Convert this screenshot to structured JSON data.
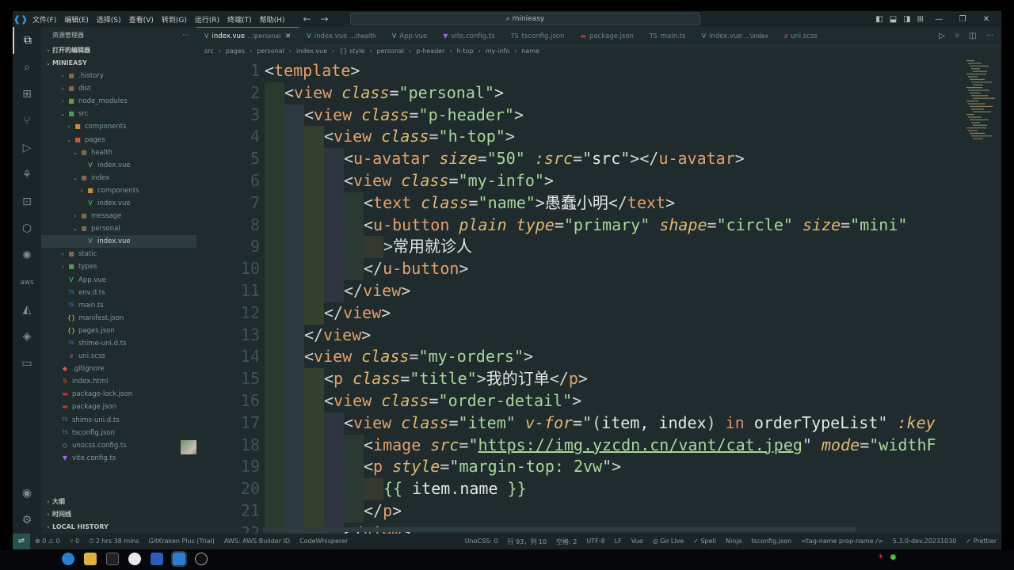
{
  "title_bar": {
    "menu": [
      "文件(F)",
      "编辑(E)",
      "选择(S)",
      "查看(V)",
      "转到(G)",
      "运行(R)",
      "终端(T)",
      "帮助(H)"
    ],
    "search": "minieasy"
  },
  "sidebar": {
    "title": "资源管理器",
    "open_editors": "打开的编辑器",
    "project": "MINIEASY",
    "tree": [
      {
        "name": ".history",
        "depth": 1,
        "kind": "folder",
        "icon_color": "#7a6a55"
      },
      {
        "name": "dist",
        "depth": 1,
        "kind": "folder",
        "icon_color": "#7a6a55"
      },
      {
        "name": "node_modules",
        "depth": 1,
        "kind": "folder",
        "icon_color": "#6e9a4e"
      },
      {
        "name": "src",
        "depth": 1,
        "kind": "folder-open",
        "icon_color": "#4d9d5f"
      },
      {
        "name": "components",
        "depth": 2,
        "kind": "folder",
        "icon_color": "#c9883a"
      },
      {
        "name": "pages",
        "depth": 2,
        "kind": "folder-open",
        "icon_color": "#c95a3a"
      },
      {
        "name": "health",
        "depth": 3,
        "kind": "folder-open",
        "icon_color": "#7a6a55"
      },
      {
        "name": "index.vue",
        "depth": 4,
        "kind": "vue",
        "icon_color": "#4fc08d"
      },
      {
        "name": "index",
        "depth": 3,
        "kind": "folder-open",
        "icon_color": "#7a6a55"
      },
      {
        "name": "components",
        "depth": 4,
        "kind": "folder",
        "icon_color": "#c9883a"
      },
      {
        "name": "index.vue",
        "depth": 4,
        "kind": "vue",
        "icon_color": "#4fc08d"
      },
      {
        "name": "message",
        "depth": 3,
        "kind": "folder",
        "icon_color": "#7a6a55"
      },
      {
        "name": "personal",
        "depth": 3,
        "kind": "folder-open",
        "icon_color": "#7a6a55"
      },
      {
        "name": "index.vue",
        "depth": 4,
        "kind": "vue",
        "icon_color": "#4fc08d",
        "selected": true
      },
      {
        "name": "static",
        "depth": 1,
        "kind": "folder",
        "icon_color": "#7a6a55"
      },
      {
        "name": "types",
        "depth": 1,
        "kind": "folder",
        "icon_color": "#4d9d5f"
      },
      {
        "name": "App.vue",
        "depth": 1,
        "kind": "vue",
        "icon_color": "#4fc08d"
      },
      {
        "name": "env.d.ts",
        "depth": 1,
        "kind": "ts",
        "icon_color": "#3a8fd8"
      },
      {
        "name": "main.ts",
        "depth": 1,
        "kind": "ts",
        "icon_color": "#3a8fd8"
      },
      {
        "name": "manifest.json",
        "depth": 1,
        "kind": "json",
        "icon_color": "#d8c050"
      },
      {
        "name": "pages.json",
        "depth": 1,
        "kind": "json",
        "icon_color": "#d8c050"
      },
      {
        "name": "shime-uni.d.ts",
        "depth": 1,
        "kind": "ts",
        "icon_color": "#3a8fd8"
      },
      {
        "name": "uni.scss",
        "depth": 1,
        "kind": "scss",
        "icon_color": "#c76494"
      },
      {
        "name": ".gitignore",
        "depth": 0,
        "kind": "git",
        "icon_color": "#e05a3a"
      },
      {
        "name": "index.html",
        "depth": 0,
        "kind": "html",
        "icon_color": "#e06a3a"
      },
      {
        "name": "package-lock.json",
        "depth": 0,
        "kind": "npm",
        "icon_color": "#c03a3a"
      },
      {
        "name": "package.json",
        "depth": 0,
        "kind": "npm",
        "icon_color": "#c03a3a"
      },
      {
        "name": "shims-uni.d.ts",
        "depth": 0,
        "kind": "ts",
        "icon_color": "#3a8fd8"
      },
      {
        "name": "tsconfig.json",
        "depth": 0,
        "kind": "ts",
        "icon_color": "#3a8fd8"
      },
      {
        "name": "unocss.config.ts",
        "depth": 0,
        "kind": "uno",
        "icon_color": "#aaaaaa"
      },
      {
        "name": "vite.config.ts",
        "depth": 0,
        "kind": "vite",
        "icon_color": "#9a6af0"
      }
    ],
    "bottom_sections": [
      "大纲",
      "时间线",
      "LOCAL HISTORY"
    ]
  },
  "editor": {
    "tabs": [
      {
        "name": "index.vue",
        "desc": "...\\personal",
        "icon": "V",
        "icon_color": "#4fc08d",
        "active": true
      },
      {
        "name": "index.vue",
        "desc": "...\\health",
        "icon": "V",
        "icon_color": "#4fc08d"
      },
      {
        "name": "App.vue",
        "desc": "",
        "icon": "V",
        "icon_color": "#4fc08d"
      },
      {
        "name": "vite.config.ts",
        "desc": "",
        "icon": "▼",
        "icon_color": "#9a6af0"
      },
      {
        "name": "tsconfig.json",
        "desc": "",
        "icon": "TS",
        "icon_color": "#3a8fd8"
      },
      {
        "name": "package.json",
        "desc": "",
        "icon": "▬",
        "icon_color": "#c03a3a"
      },
      {
        "name": "main.ts",
        "desc": "",
        "icon": "TS",
        "icon_color": "#3a8fd8"
      },
      {
        "name": "index.vue",
        "desc": "...\\index",
        "icon": "V",
        "icon_color": "#4fc08d"
      },
      {
        "name": "uni.scss",
        "desc": "",
        "icon": "∂",
        "icon_color": "#c76494"
      }
    ],
    "breadcrumb": [
      "src",
      "pages",
      "personal",
      "index.vue",
      "{} style",
      "personal",
      "p-header",
      "h-top",
      "my-info",
      "name"
    ],
    "lines": [
      {
        "n": 1,
        "i": 0,
        "tokens": [
          [
            "punc",
            "<"
          ],
          [
            "tag",
            "template"
          ],
          [
            "punc",
            ">"
          ]
        ]
      },
      {
        "n": 2,
        "i": 1,
        "tokens": [
          [
            "punc",
            "<"
          ],
          [
            "tag",
            "view "
          ],
          [
            "attr",
            "class"
          ],
          [
            "punc",
            "="
          ],
          [
            "str",
            "\"personal\""
          ],
          [
            "punc",
            ">"
          ]
        ]
      },
      {
        "n": 3,
        "i": 2,
        "tokens": [
          [
            "punc",
            "<"
          ],
          [
            "tag",
            "view "
          ],
          [
            "attr",
            "class"
          ],
          [
            "punc",
            "="
          ],
          [
            "str",
            "\"p-header\""
          ],
          [
            "punc",
            ">"
          ]
        ]
      },
      {
        "n": 4,
        "i": 3,
        "tokens": [
          [
            "punc",
            "<"
          ],
          [
            "tag",
            "view "
          ],
          [
            "attr",
            "class"
          ],
          [
            "punc",
            "="
          ],
          [
            "str",
            "\"h-top\""
          ],
          [
            "punc",
            ">"
          ]
        ]
      },
      {
        "n": 5,
        "i": 4,
        "tokens": [
          [
            "punc",
            "<"
          ],
          [
            "tag",
            "u-avatar "
          ],
          [
            "attr",
            "size"
          ],
          [
            "punc",
            "="
          ],
          [
            "str",
            "\"50\""
          ],
          [
            "plain",
            " "
          ],
          [
            "attr",
            ":src"
          ],
          [
            "punc",
            "="
          ],
          [
            "punc",
            "\""
          ],
          [
            "plain",
            "src"
          ],
          [
            "punc",
            "\">"
          ],
          [
            "punc",
            "</"
          ],
          [
            "tag",
            "u-avatar"
          ],
          [
            "punc",
            ">"
          ]
        ]
      },
      {
        "n": 6,
        "i": 4,
        "tokens": [
          [
            "punc",
            "<"
          ],
          [
            "tag",
            "view "
          ],
          [
            "attr",
            "class"
          ],
          [
            "punc",
            "="
          ],
          [
            "str",
            "\"my-info\""
          ],
          [
            "punc",
            ">"
          ]
        ]
      },
      {
        "n": 7,
        "i": 5,
        "tokens": [
          [
            "punc",
            "<"
          ],
          [
            "tag",
            "text "
          ],
          [
            "attr",
            "class"
          ],
          [
            "punc",
            "="
          ],
          [
            "str",
            "\"name\""
          ],
          [
            "punc",
            ">"
          ],
          [
            "plain",
            "愚蠢小明"
          ],
          [
            "punc",
            "</"
          ],
          [
            "tag",
            "text"
          ],
          [
            "punc",
            ">"
          ]
        ]
      },
      {
        "n": 8,
        "i": 5,
        "tokens": [
          [
            "punc",
            "<"
          ],
          [
            "tag",
            "u-button "
          ],
          [
            "attr",
            "plain type"
          ],
          [
            "punc",
            "="
          ],
          [
            "str",
            "\"primary\" "
          ],
          [
            "attr",
            "shape"
          ],
          [
            "punc",
            "="
          ],
          [
            "str",
            "\"circle\" "
          ],
          [
            "attr",
            "size"
          ],
          [
            "punc",
            "="
          ],
          [
            "str",
            "\"mini\""
          ]
        ]
      },
      {
        "n": 9,
        "i": 6,
        "tokens": [
          [
            "punc",
            ">"
          ],
          [
            "plain",
            "常用就诊人"
          ]
        ]
      },
      {
        "n": 10,
        "i": 5,
        "tokens": [
          [
            "punc",
            "</"
          ],
          [
            "tag",
            "u-button"
          ],
          [
            "punc",
            ">"
          ]
        ]
      },
      {
        "n": 11,
        "i": 4,
        "tokens": [
          [
            "punc",
            "</"
          ],
          [
            "tag",
            "view"
          ],
          [
            "punc",
            ">"
          ]
        ]
      },
      {
        "n": 12,
        "i": 3,
        "tokens": [
          [
            "punc",
            "</"
          ],
          [
            "tag",
            "view"
          ],
          [
            "punc",
            ">"
          ]
        ]
      },
      {
        "n": 13,
        "i": 2,
        "tokens": [
          [
            "punc",
            "</"
          ],
          [
            "tag",
            "view"
          ],
          [
            "punc",
            ">"
          ]
        ]
      },
      {
        "n": 14,
        "i": 2,
        "tokens": [
          [
            "punc",
            "<"
          ],
          [
            "tag",
            "view "
          ],
          [
            "attr",
            "class"
          ],
          [
            "punc",
            "="
          ],
          [
            "str",
            "\"my-orders\""
          ],
          [
            "punc",
            ">"
          ]
        ]
      },
      {
        "n": 15,
        "i": 3,
        "tokens": [
          [
            "punc",
            "<"
          ],
          [
            "tag",
            "p "
          ],
          [
            "attr",
            "class"
          ],
          [
            "punc",
            "="
          ],
          [
            "str",
            "\"title\""
          ],
          [
            "punc",
            ">"
          ],
          [
            "plain",
            "我的订单"
          ],
          [
            "punc",
            "</"
          ],
          [
            "tag",
            "p"
          ],
          [
            "punc",
            ">"
          ]
        ]
      },
      {
        "n": 16,
        "i": 3,
        "tokens": [
          [
            "punc",
            "<"
          ],
          [
            "tag",
            "view "
          ],
          [
            "attr",
            "class"
          ],
          [
            "punc",
            "="
          ],
          [
            "str",
            "\"order-detail\""
          ],
          [
            "punc",
            ">"
          ]
        ]
      },
      {
        "n": 17,
        "i": 4,
        "tokens": [
          [
            "punc",
            "<"
          ],
          [
            "tag",
            "view "
          ],
          [
            "attr",
            "class"
          ],
          [
            "punc",
            "="
          ],
          [
            "str",
            "\"item\" "
          ],
          [
            "attr",
            "v-for"
          ],
          [
            "punc",
            "=\"("
          ],
          [
            "plain",
            "item, index"
          ],
          [
            "punc",
            ") "
          ],
          [
            "kw",
            "in "
          ],
          [
            "plain",
            "orderTypeList"
          ],
          [
            "punc",
            "\" "
          ],
          [
            "attr",
            ":key"
          ]
        ]
      },
      {
        "n": 18,
        "i": 5,
        "tokens": [
          [
            "punc",
            "<"
          ],
          [
            "tag",
            "image "
          ],
          [
            "attr",
            "src"
          ],
          [
            "punc",
            "=\""
          ],
          [
            "link",
            "https://img.yzcdn.cn/vant/cat.jpeg"
          ],
          [
            "punc",
            "\" "
          ],
          [
            "attr",
            "mode"
          ],
          [
            "punc",
            "="
          ],
          [
            "str",
            "\"widthF"
          ]
        ]
      },
      {
        "n": 19,
        "i": 5,
        "tokens": [
          [
            "punc",
            "<"
          ],
          [
            "tag",
            "p "
          ],
          [
            "attr",
            "style"
          ],
          [
            "punc",
            "=\""
          ],
          [
            "str",
            "margin-top: 2vw"
          ],
          [
            "punc",
            "\">"
          ]
        ]
      },
      {
        "n": 20,
        "i": 6,
        "tokens": [
          [
            "str",
            "{{ "
          ],
          [
            "plain",
            "item"
          ],
          [
            "punc",
            "."
          ],
          [
            "plain",
            "name "
          ],
          [
            "str",
            "}}"
          ]
        ]
      },
      {
        "n": 21,
        "i": 5,
        "tokens": [
          [
            "punc",
            "</"
          ],
          [
            "tag",
            "p"
          ],
          [
            "punc",
            ">"
          ]
        ]
      },
      {
        "n": 22,
        "i": 4,
        "tokens": [
          [
            "punc",
            "</"
          ],
          [
            "tag",
            "view"
          ],
          [
            "punc",
            ">"
          ]
        ]
      }
    ]
  },
  "status_bar": {
    "left": [
      "⊗ 0 ⚠ 0",
      "⑂ 0",
      "⏱ 2 hrs 38 mins",
      "GitKraken Plus (Trial)",
      "AWS: AWS Builder ID",
      "CodeWhisperer"
    ],
    "right": [
      "UnoCSS: 0",
      "行 93，列 10",
      "空格: 2",
      "UTF-8",
      "LF",
      "Vue",
      "◎ Go Live",
      "✓ Spell",
      "Ninja",
      "tsconfig.json",
      "<tag-name prop-name />",
      "5.3.0-dev.20231030",
      "✓ Prettier"
    ]
  },
  "colors": {
    "editor_bg": "#1f2b2d",
    "tag": "#e5a06a",
    "attr": "#e0b870",
    "string": "#a8d89a",
    "accent": "#3a8fd8"
  }
}
